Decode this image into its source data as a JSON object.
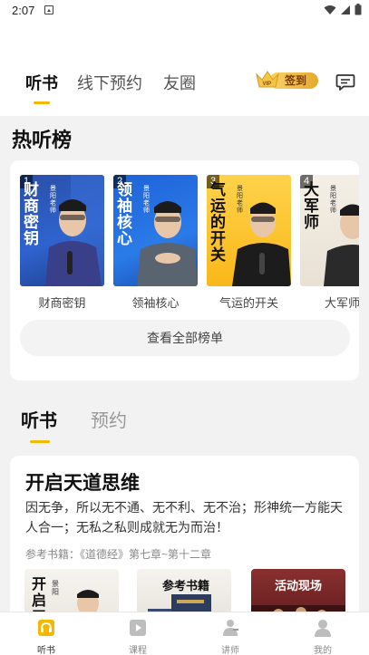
{
  "status_bar": {
    "time": "2:07"
  },
  "top_tabs": [
    {
      "label": "听书",
      "active": true
    },
    {
      "label": "线下预约",
      "active": false
    },
    {
      "label": "友圈",
      "active": false
    }
  ],
  "vip_badge": {
    "label": "签到",
    "crown_text": "VIP"
  },
  "rank_section": {
    "title": "热听榜",
    "items": [
      {
        "rank": "1",
        "cover_title": "财商密钥",
        "author": "景阳老师",
        "label": "财商密钥"
      },
      {
        "rank": "2",
        "cover_title": "领袖核心",
        "author": "景阳老师",
        "label": "领袖核心"
      },
      {
        "rank": "3",
        "cover_title": "气运的开关",
        "author": "景阳老师",
        "label": "气运的开关"
      },
      {
        "rank": "4",
        "cover_title": "大军师",
        "author": "景阳老师",
        "label": "大军师"
      }
    ],
    "view_all": "查看全部榜单"
  },
  "sub_tabs": [
    {
      "label": "听书",
      "active": true
    },
    {
      "label": "预约",
      "active": false
    }
  ],
  "course": {
    "title": "开启天道思维",
    "description": "因无争，所以无不通、无不利、无不治；形神统一方能天人合一；无私之私则成就无为而治！",
    "reference": "参考书籍：《道德经》第七章~第十二章",
    "thumbs": [
      {
        "text": "开启天",
        "author": "景阳"
      },
      {
        "text": "参考书籍"
      },
      {
        "text": "活动现场"
      }
    ]
  },
  "bottom_nav": [
    {
      "label": "听书",
      "icon": "headphones-book-icon",
      "active": true
    },
    {
      "label": "课程",
      "icon": "play-book-icon",
      "active": false
    },
    {
      "label": "讲师",
      "icon": "lecturer-icon",
      "active": false
    },
    {
      "label": "我的",
      "icon": "profile-icon",
      "active": false
    }
  ],
  "colors": {
    "accent": "#f5b800",
    "background": "#f2f2f2"
  }
}
